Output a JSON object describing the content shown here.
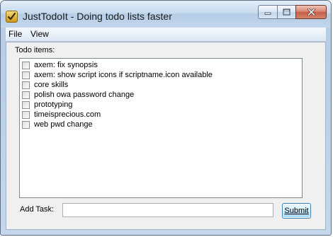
{
  "window": {
    "title": "JustTodoIt - Doing todo lists faster",
    "app_icon": "checkmark-app-icon"
  },
  "caption_buttons": {
    "minimize_icon": "minimize-icon",
    "maximize_icon": "maximize-icon",
    "close_icon": "close-icon"
  },
  "menu": {
    "items": [
      {
        "label": "File"
      },
      {
        "label": "View"
      }
    ]
  },
  "todo": {
    "label": "Todo items:",
    "items": [
      {
        "text": "axem: fix synopsis",
        "checked": false
      },
      {
        "text": "axem: show script icons if scriptname.icon available",
        "checked": false
      },
      {
        "text": "core skills",
        "checked": false
      },
      {
        "text": "polish owa password change",
        "checked": false
      },
      {
        "text": "prototyping",
        "checked": false
      },
      {
        "text": "timeisprecious.com",
        "checked": false
      },
      {
        "text": "web pwd change",
        "checked": false
      }
    ]
  },
  "add_task": {
    "label": "Add Task:",
    "value": "",
    "submit_label": "Submit"
  },
  "colors": {
    "close_button": "#c55e47",
    "submit_border": "#3c7fb1"
  }
}
